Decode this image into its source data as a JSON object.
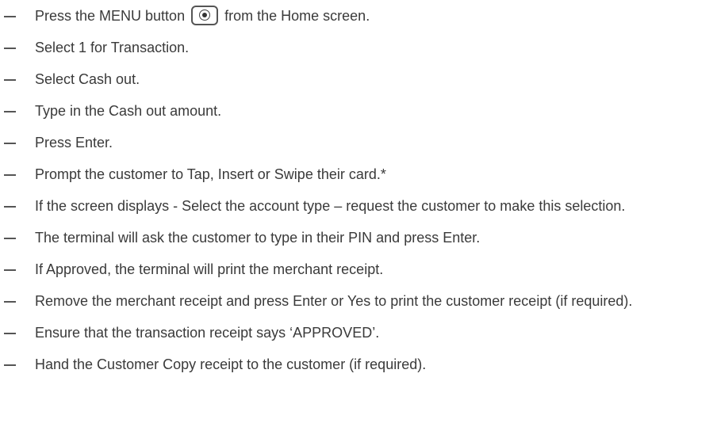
{
  "steps": [
    {
      "before_icon": "Press the MENU button",
      "icon": "menu-button-icon",
      "after_icon": "from the Home screen."
    },
    {
      "text": "Select 1 for Transaction."
    },
    {
      "text": "Select Cash out."
    },
    {
      "text": "Type in the Cash out amount."
    },
    {
      "text": "Press Enter."
    },
    {
      "text": "Prompt the customer to Tap, Insert or Swipe their card.*"
    },
    {
      "text": "If the screen displays - Select the account type – request the customer to make this selection."
    },
    {
      "text": "The terminal will ask the customer to type in their PIN and press Enter."
    },
    {
      "text": "If Approved, the terminal will print the merchant receipt."
    },
    {
      "text": "Remove the merchant receipt and press Enter or Yes to print the customer receipt (if required)."
    },
    {
      "text": "Ensure that the transaction receipt says ‘APPROVED’."
    },
    {
      "text": "Hand the Customer Copy receipt to the customer (if required)."
    }
  ]
}
